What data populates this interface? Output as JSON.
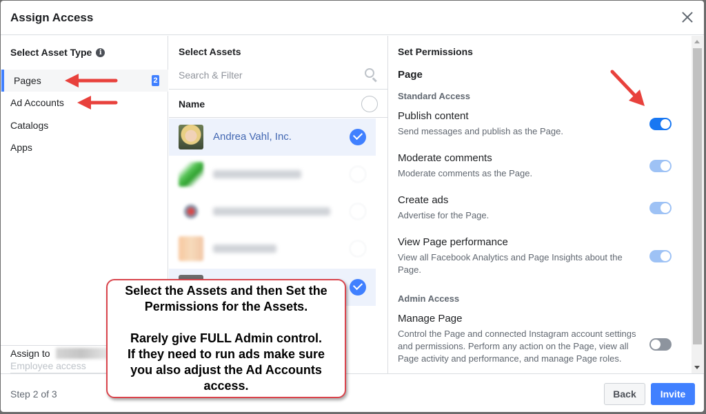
{
  "dialog": {
    "title": "Assign Access",
    "close_icon": "close-icon"
  },
  "asset_types": {
    "heading": "Select Asset Type",
    "info_icon": "i",
    "items": [
      {
        "label": "Pages",
        "active": true,
        "badge": "2"
      },
      {
        "label": "Ad Accounts",
        "active": false
      },
      {
        "label": "Catalogs",
        "active": false
      },
      {
        "label": "Apps",
        "active": false
      }
    ]
  },
  "assets": {
    "heading": "Select Assets",
    "search_placeholder": "Search & Filter",
    "column_header": "Name",
    "rows": [
      {
        "name": "Andrea Vahl, Inc.",
        "selected": true,
        "blurred": false
      },
      {
        "name": "",
        "selected": false,
        "blurred": true
      },
      {
        "name": "",
        "selected": false,
        "blurred": true
      },
      {
        "name": "",
        "selected": false,
        "blurred": true
      },
      {
        "name": "",
        "selected": true,
        "blurred": true
      }
    ]
  },
  "assign": {
    "label": "Assign to",
    "sublabel": "Employee access"
  },
  "permissions": {
    "heading": "Set Permissions",
    "asset_type_title": "Page",
    "standard_section": "Standard Access",
    "admin_section": "Admin Access",
    "standard": [
      {
        "title": "Publish content",
        "description": "Send messages and publish as the Page.",
        "state": "on"
      },
      {
        "title": "Moderate comments",
        "description": "Moderate comments as the Page.",
        "state": "on-disabled"
      },
      {
        "title": "Create ads",
        "description": "Advertise for the Page.",
        "state": "on-disabled"
      },
      {
        "title": "View Page performance",
        "description": "View all Facebook Analytics and Page Insights about the Page.",
        "state": "on-disabled"
      }
    ],
    "admin": [
      {
        "title": "Manage Page",
        "description": "Control the Page and connected Instagram account settings and permissions. Perform any action on the Page, view all Page activity and performance, and manage Page roles.",
        "state": "off"
      }
    ]
  },
  "footer": {
    "step": "Step 2 of 3",
    "back_label": "Back",
    "invite_label": "Invite"
  },
  "annotation": {
    "line1": "Select the Assets and then Set the",
    "line2": "Permissions for the Assets.",
    "line3": "Rarely give FULL Admin control.",
    "line4": "If they need to run ads make sure",
    "line5": "you also adjust the Ad Accounts",
    "line6": "access.",
    "arrow_color": "#e8413c",
    "border_color": "#d9434b"
  },
  "colors": {
    "accent": "#4080ff",
    "toggle_on": "#1877f2",
    "toggle_on_disabled": "#9ec2f5",
    "toggle_off": "#8d949e",
    "link": "#4267b2"
  }
}
